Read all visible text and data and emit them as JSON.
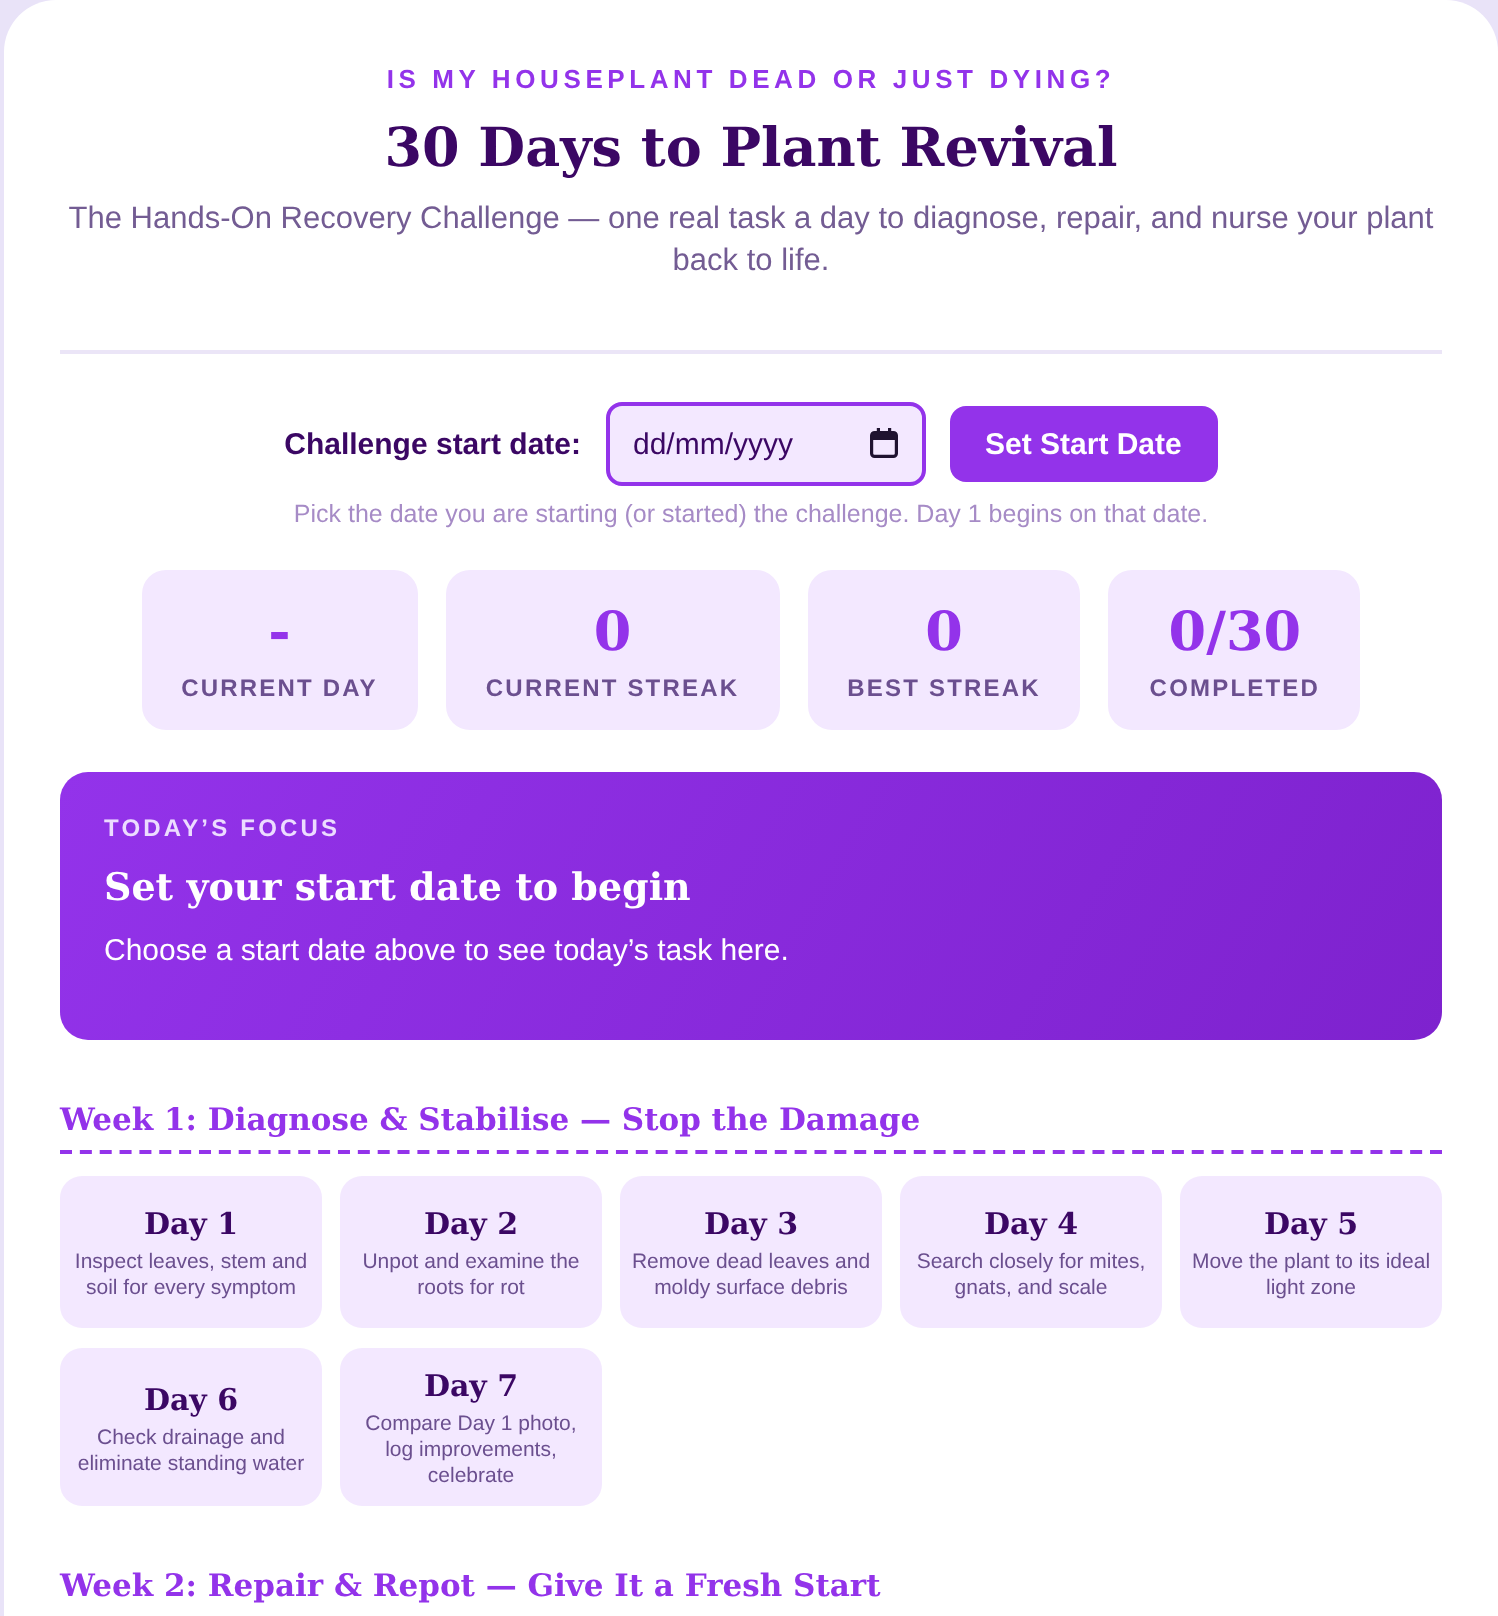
{
  "header": {
    "kicker": "IS MY HOUSEPLANT DEAD OR JUST DYING?",
    "title": "30 Days to Plant Revival",
    "subtitle": "The Hands-On Recovery Challenge — one real task a day to diagnose, repair, and nurse your plant back to life."
  },
  "start_date": {
    "label": "Challenge start date:",
    "placeholder": "dd/mm/yyyy",
    "button": "Set Start Date",
    "hint": "Pick the date you are starting (or started) the challenge. Day 1 begins on that date."
  },
  "stats": [
    {
      "value": "-",
      "label": "CURRENT DAY"
    },
    {
      "value": "0",
      "label": "CURRENT STREAK"
    },
    {
      "value": "0",
      "label": "BEST STREAK"
    },
    {
      "value": "0/30",
      "label": "COMPLETED"
    }
  ],
  "focus": {
    "kicker": "TODAY’S FOCUS",
    "title": "Set your start date to begin",
    "text": "Choose a start date above to see today’s task here."
  },
  "weeks": [
    {
      "title": "Week 1: Diagnose & Stabilise — Stop the Damage",
      "days": [
        {
          "title": "Day 1",
          "task": "Inspect leaves, stem and soil for every symptom"
        },
        {
          "title": "Day 2",
          "task": "Unpot and examine the roots for rot"
        },
        {
          "title": "Day 3",
          "task": "Remove dead leaves and moldy surface debris"
        },
        {
          "title": "Day 4",
          "task": "Search closely for mites, gnats, and scale"
        },
        {
          "title": "Day 5",
          "task": "Move the plant to its ideal light zone"
        },
        {
          "title": "Day 6",
          "task": "Check drainage and eliminate standing water"
        },
        {
          "title": "Day 7",
          "task": "Compare Day 1 photo, log improvements, celebrate"
        }
      ]
    },
    {
      "title": "Week 2: Repair & Repot — Give It a Fresh Start"
    }
  ]
}
